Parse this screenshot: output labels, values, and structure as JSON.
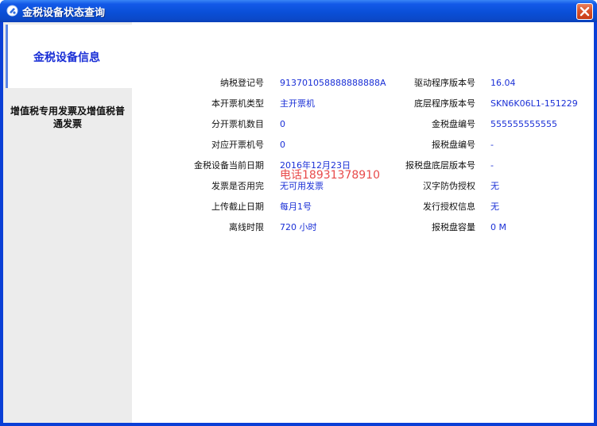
{
  "window": {
    "title": "金税设备状态查询"
  },
  "sidebar": {
    "active_item": "金税设备信息",
    "items": [
      {
        "label": "增值税专用发票及增值税普通发票"
      }
    ]
  },
  "info": {
    "left": [
      {
        "label": "纳税登记号",
        "value": "913701058888888888A"
      },
      {
        "label": "本开票机类型",
        "value": "主开票机"
      },
      {
        "label": "分开票机数目",
        "value": "0"
      },
      {
        "label": "对应开票机号",
        "value": "0"
      },
      {
        "label": "金税设备当前日期",
        "value": "2016年12月23日"
      },
      {
        "label": "发票是否用完",
        "value": "无可用发票"
      },
      {
        "label": "上传截止日期",
        "value": "每月1号"
      },
      {
        "label": "离线时限",
        "value": "720 小时"
      }
    ],
    "right": [
      {
        "label": "驱动程序版本号",
        "value": "16.04"
      },
      {
        "label": "底层程序版本号",
        "value": "SKN6K06L1-151229"
      },
      {
        "label": "金税盘编号",
        "value": "555555555555"
      },
      {
        "label": "报税盘编号",
        "value": "-"
      },
      {
        "label": "报税盘底层版本号",
        "value": "-"
      },
      {
        "label": "汉字防伪授权",
        "value": "无"
      },
      {
        "label": "发行授权信息",
        "value": "无"
      },
      {
        "label": "报税盘容量",
        "value": "0 M"
      }
    ]
  },
  "watermark": "电话18931378910",
  "colors": {
    "titlebar": "#0a4fd8",
    "accent_text": "#1a2fd6",
    "sidebar_bg": "#ececec",
    "close_button": "#d9522b",
    "watermark": "#e84a4a"
  },
  "icons": {
    "title": "app-icon",
    "close": "close-icon"
  }
}
